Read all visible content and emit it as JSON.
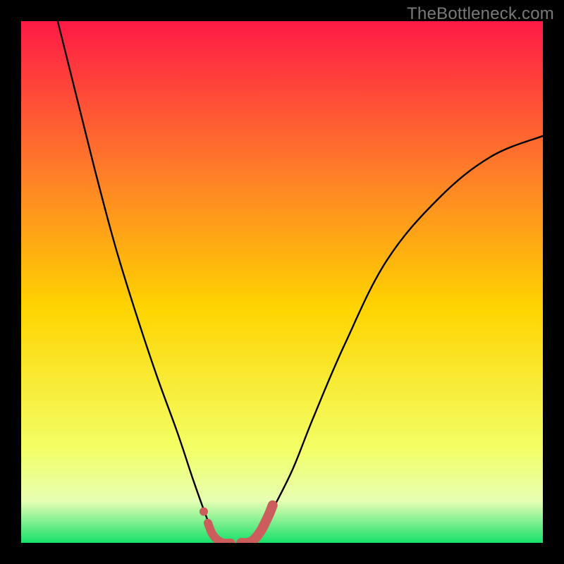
{
  "watermark": "TheBottleneck.com",
  "colors": {
    "frame": "#000000",
    "gradient_top": "#ff1a46",
    "gradient_mid_upper": "#ff7a2a",
    "gradient_mid": "#ffd400",
    "gradient_lower": "#f3ff66",
    "gradient_band_pale": "#e6ffb3",
    "gradient_bottom": "#17e06a",
    "curve": "#000000",
    "marker_fill": "#cc5d5d",
    "marker_stroke": "#cc5d5d"
  },
  "chart_data": {
    "type": "line",
    "title": "",
    "xlabel": "",
    "ylabel": "",
    "xlim": [
      0,
      100
    ],
    "ylim": [
      0,
      100
    ],
    "grid": false,
    "legend": null,
    "series": [
      {
        "name": "bottleneck-curve-left",
        "x": [
          7,
          10,
          14,
          18,
          22,
          26,
          30,
          33,
          35.5,
          37.5
        ],
        "y": [
          100,
          88,
          72,
          57,
          44,
          32,
          21,
          12,
          5,
          0
        ]
      },
      {
        "name": "bottleneck-curve-right",
        "x": [
          45,
          48,
          52,
          56,
          62,
          70,
          80,
          90,
          100
        ],
        "y": [
          0,
          6,
          14,
          24,
          38,
          54,
          66,
          74,
          78
        ]
      }
    ],
    "markers": [
      {
        "name": "marker-dot-upper",
        "x": 35.0,
        "y": 6.0,
        "size": 6
      },
      {
        "name": "marker-segment-left",
        "path": [
          [
            35.8,
            3.8
          ],
          [
            36.6,
            1.8
          ],
          [
            37.6,
            0.6
          ],
          [
            38.8,
            0.0
          ],
          [
            40.2,
            0.0
          ]
        ],
        "width": 12
      },
      {
        "name": "marker-segment-right",
        "path": [
          [
            42.2,
            0.0
          ],
          [
            43.4,
            0.0
          ],
          [
            44.6,
            0.6
          ],
          [
            46.0,
            2.4
          ],
          [
            47.4,
            5.2
          ],
          [
            48.2,
            7.2
          ]
        ],
        "width": 14
      }
    ]
  }
}
